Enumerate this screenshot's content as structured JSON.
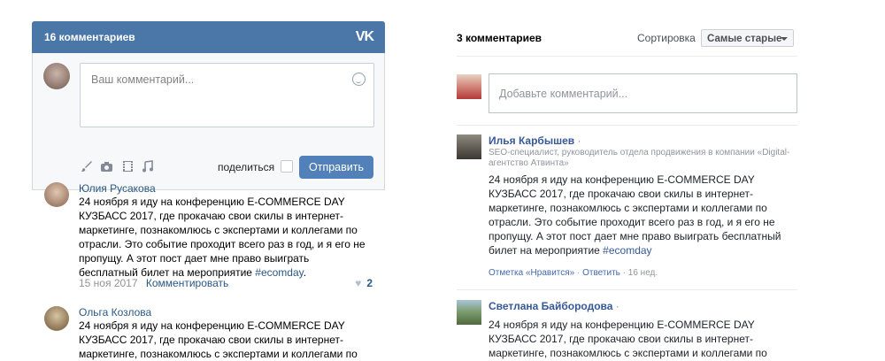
{
  "vk_widget": {
    "header_count": "16 комментариев",
    "logo": "VK",
    "placeholder": "Ваш комментарий...",
    "share_label": "поделиться",
    "send_label": "Отправить",
    "tool_icons": [
      "brush-icon",
      "camera-icon",
      "video-icon",
      "music-icon"
    ],
    "comments": [
      {
        "author": "Юлия Русакова",
        "text": "24 ноября я иду на конференцию E-COMMERCE DAY КУЗБАСС 2017, где прокачаю свои скилы в интернет-маркетинге, познакомлюсь с экспертами и коллегами по отрасли. Это событие проходит всего раз в год, и я его не пропущу. А этот пост дает мне право выиграть бесплатный билет на мероприятие ",
        "hashtag": "#ecomday",
        "date": "15 ноя 2017",
        "reply": "Комментировать",
        "likes": "2"
      },
      {
        "author": "Ольга Козлова",
        "text": "24 ноября я иду на конференцию E-COMMERCE DAY КУЗБАСС 2017, где прокачаю свои скилы в интернет-маркетинге, познакомлюсь с экспертами и коллегами по"
      }
    ]
  },
  "fb_widget": {
    "count": "3 комментариев",
    "sort_label": "Сортировка",
    "sort_value": "Самые старые",
    "placeholder": "Добавьте комментарий...",
    "comments": [
      {
        "author": "Илья Карбышев",
        "role": "SEO-специалист, руководитель отдела продвижения в компании «Digital-агентство Атвинта»",
        "text": "24 ноября я иду на конференцию E-COMMERCE DAY КУЗБАСС 2017, где прокачаю свои скилы в интернет-маркетинге, познакомлюсь с экспертами и коллегами по отрасли. Это событие проходит всего раз в год, и я его не пропущу. А этот пост дает мне право выиграть бесплатный билет на мероприятие ",
        "hashtag": "#ecomday",
        "like_label": "Отметка «Нравится»",
        "reply_label": "Ответить",
        "time": "16 нед."
      },
      {
        "author": "Светлана Байбородова",
        "text": "24 ноября я иду на конференцию E-COMMERCE DAY КУЗБАСС 2017, где прокачаю свои скилы в интернет-маркетинге, познакомлюсь с экспертами и коллегами по"
      }
    ]
  },
  "colors": {
    "vk_header": "#4a76a8",
    "vk_button": "#5181b8",
    "vk_link": "#2a5885",
    "fb_link": "#365899"
  }
}
